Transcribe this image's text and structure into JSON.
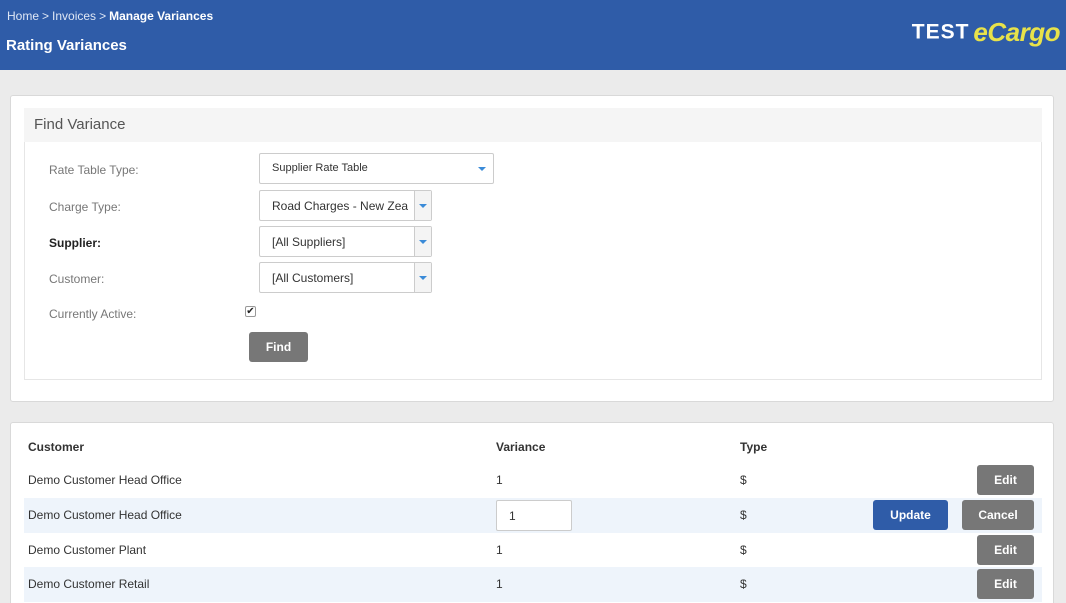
{
  "header": {
    "breadcrumb": [
      "Home",
      "Invoices",
      "Manage Variances"
    ],
    "breadcrumb_separator": ">",
    "title": "Rating Variances",
    "logo_test": "TEST",
    "logo_ecargo": "eCargo"
  },
  "find": {
    "heading": "Find Variance",
    "rate_table_type": {
      "label": "Rate Table Type:",
      "value": "Supplier Rate Table"
    },
    "charge_type": {
      "label": "Charge Type:",
      "value": "Road Charges - New Zea"
    },
    "supplier": {
      "label": "Supplier:",
      "value": "[All Suppliers]"
    },
    "customer": {
      "label": "Customer:",
      "value": "[All Customers]"
    },
    "currently_active": {
      "label": "Currently Active:",
      "checked": true,
      "mark": "✔"
    },
    "find_button": "Find"
  },
  "results": {
    "columns": {
      "customer": "Customer",
      "variance": "Variance",
      "type": "Type"
    },
    "rows": [
      {
        "customer": "Demo Customer Head Office",
        "variance": "1",
        "type": "$",
        "edit_label": "Edit"
      },
      {
        "customer": "Demo Customer Head Office",
        "variance": "1",
        "type": "$",
        "update_label": "Update",
        "cancel_label": "Cancel",
        "editing": true
      },
      {
        "customer": "Demo Customer Plant",
        "variance": "1",
        "type": "$",
        "edit_label": "Edit"
      },
      {
        "customer": "Demo Customer Retail",
        "variance": "1",
        "type": "$",
        "edit_label": "Edit"
      }
    ]
  },
  "colors": {
    "header": "#2f5ca8",
    "logo_accent": "#e8e24a",
    "button_grey": "#777777",
    "button_blue": "#2f5ca8",
    "row_alt": "#eef4fb"
  }
}
